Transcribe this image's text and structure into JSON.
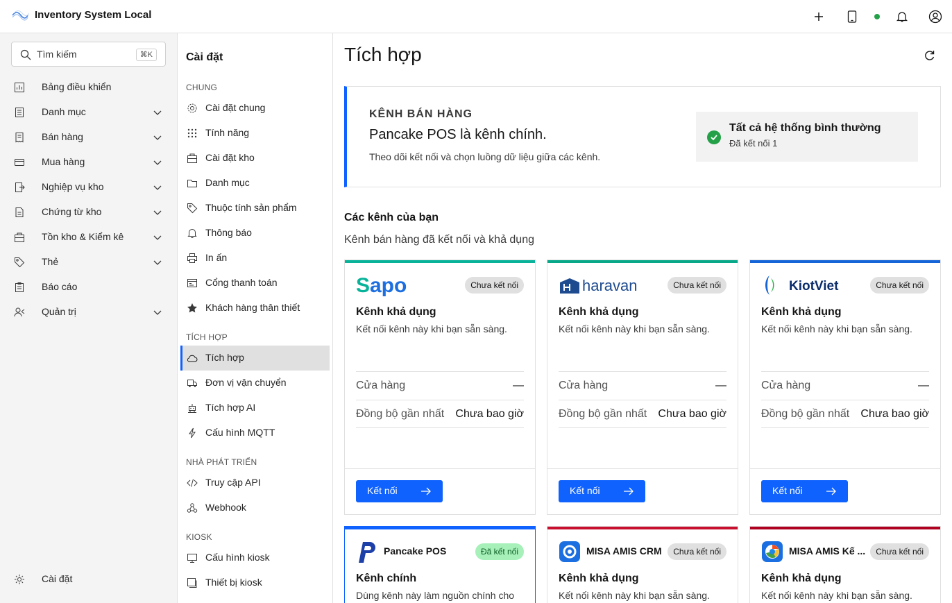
{
  "app": {
    "title": "Inventory System Local"
  },
  "search": {
    "placeholder": "Tìm kiếm",
    "shortcut": "⌘K"
  },
  "leftnav": {
    "items": [
      {
        "label": "Bảng điều khiển",
        "icon": "dashboard-icon"
      },
      {
        "label": "Danh mục",
        "icon": "catalog-icon"
      },
      {
        "label": "Bán hàng",
        "icon": "sales-icon"
      },
      {
        "label": "Mua hàng",
        "icon": "purchase-icon"
      },
      {
        "label": "Nghiệp vụ kho",
        "icon": "warehouse-ops-icon"
      },
      {
        "label": "Chứng từ kho",
        "icon": "document-icon"
      },
      {
        "label": "Tồn kho & Kiểm kê",
        "icon": "inventory-icon"
      },
      {
        "label": "Thẻ",
        "icon": "tag-icon"
      },
      {
        "label": "Báo cáo",
        "icon": "report-icon"
      },
      {
        "label": "Quản trị",
        "icon": "admin-icon"
      }
    ],
    "settings_label": "Cài đặt"
  },
  "settings": {
    "title": "Cài đặt",
    "sections": {
      "general": "CHUNG",
      "integration": "TÍCH HỢP",
      "developer": "NHÀ PHÁT TRIỂN",
      "kiosk": "KIOSK"
    },
    "items": [
      {
        "label": "Cài đặt chung",
        "icon": "gear-icon"
      },
      {
        "label": "Tính năng",
        "icon": "grid-icon"
      },
      {
        "label": "Cài đặt kho",
        "icon": "warehouse-icon"
      },
      {
        "label": "Danh mục",
        "icon": "folder-icon"
      },
      {
        "label": "Thuộc tính sản phẩm",
        "icon": "tag-icon"
      },
      {
        "label": "Thông báo",
        "icon": "bell-icon"
      },
      {
        "label": "In ấn",
        "icon": "printer-icon"
      },
      {
        "label": "Cổng thanh toán",
        "icon": "payment-icon"
      },
      {
        "label": "Khách hàng thân thiết",
        "icon": "star-icon"
      },
      {
        "label": "Tích hợp",
        "icon": "cloud-icon"
      },
      {
        "label": "Đơn vị vận chuyển",
        "icon": "truck-icon"
      },
      {
        "label": "Tích hợp AI",
        "icon": "robot-icon"
      },
      {
        "label": "Cấu hình MQTT",
        "icon": "lightning-icon"
      },
      {
        "label": "Truy cập API",
        "icon": "code-icon"
      },
      {
        "label": "Webhook",
        "icon": "webhook-icon"
      },
      {
        "label": "Cấu hình kiosk",
        "icon": "monitor-icon"
      },
      {
        "label": "Thiết bị kiosk",
        "icon": "device-icon"
      }
    ]
  },
  "page": {
    "title": "Tích hợp"
  },
  "banner": {
    "eyebrow": "KÊNH BÁN HÀNG",
    "title": "Pancake POS là kênh chính.",
    "description": "Theo dõi kết nối và chọn luồng dữ liệu giữa các kênh.",
    "status_title": "Tất cả hệ thống bình thường",
    "status_sub": "Đã kết nối 1"
  },
  "channels_section": {
    "title": "Các kênh của bạn",
    "subtitle": "Kênh bán hàng đã kết nối và khả dụng"
  },
  "cards": [
    {
      "name": "Sapo",
      "badge": "Chưa kết nối",
      "title": "Kênh khả dụng",
      "desc": "Kết nối kênh này khi bạn sẵn sàng.",
      "store_label": "Cửa hàng",
      "store_value": "—",
      "sync_label": "Đồng bộ gần nhất",
      "sync_value": "Chưa bao giờ",
      "button": "Kết nối",
      "accent": "#08b39a"
    },
    {
      "name": "haravan",
      "badge": "Chưa kết nối",
      "title": "Kênh khả dụng",
      "desc": "Kết nối kênh này khi bạn sẵn sàng.",
      "store_label": "Cửa hàng",
      "store_value": "—",
      "sync_label": "Đồng bộ gần nhất",
      "sync_value": "Chưa bao giờ",
      "button": "Kết nối",
      "accent": "#07a88a"
    },
    {
      "name": "KiotViet",
      "badge": "Chưa kết nối",
      "title": "Kênh khả dụng",
      "desc": "Kết nối kênh này khi bạn sẵn sàng.",
      "store_label": "Cửa hàng",
      "store_value": "—",
      "sync_label": "Đồng bộ gần nhất",
      "sync_value": "Chưa bao giờ",
      "button": "Kết nối",
      "accent": "#1565d8"
    },
    {
      "name": "Pancake POS",
      "badge": "Đã kết nối",
      "title": "Kênh chính",
      "desc": "Dùng kênh này làm nguồn chính cho",
      "accent": "#0f62fe"
    },
    {
      "name": "MISA AMIS CRM",
      "badge": "Chưa kết nối",
      "title": "Kênh khả dụng",
      "desc": "Kết nối kênh này khi bạn sẵn sàng.",
      "accent": "#c8102e"
    },
    {
      "name": "MISA AMIS Kế ...",
      "badge": "Chưa kết nối",
      "title": "Kênh khả dụng",
      "desc": "Kết nối kênh này khi bạn sẵn sàng.",
      "accent": "#b00020"
    }
  ]
}
